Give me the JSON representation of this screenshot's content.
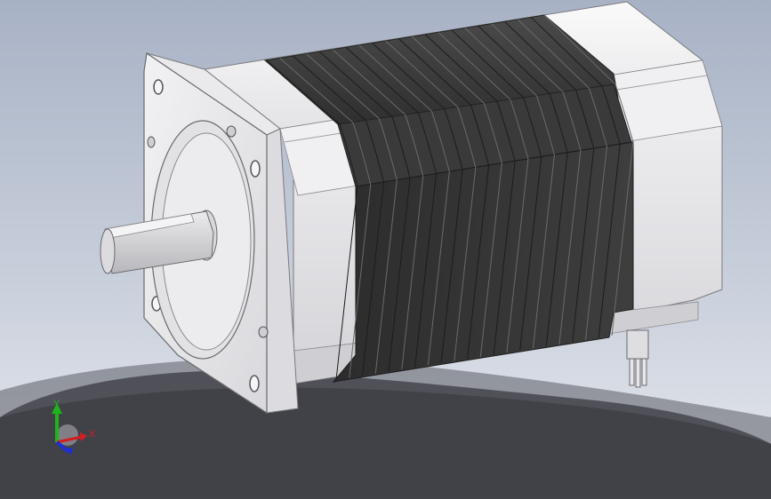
{
  "viewport": {
    "background_top": "#a9b3c6",
    "background_bottom": "#e3e6ec"
  },
  "model": {
    "body_color": "#e9e9ec",
    "lamination_dark": "#3a3a3a",
    "lamination_mid": "#5a5a5a",
    "shaft_color": "#d2d2d4",
    "shadow_color": "#2a2b30"
  },
  "triad": {
    "x_label": "X",
    "y_label": "Y",
    "x_color": "#d41e1e",
    "y_color": "#1eb41e",
    "z_color": "#1e2fd4"
  }
}
